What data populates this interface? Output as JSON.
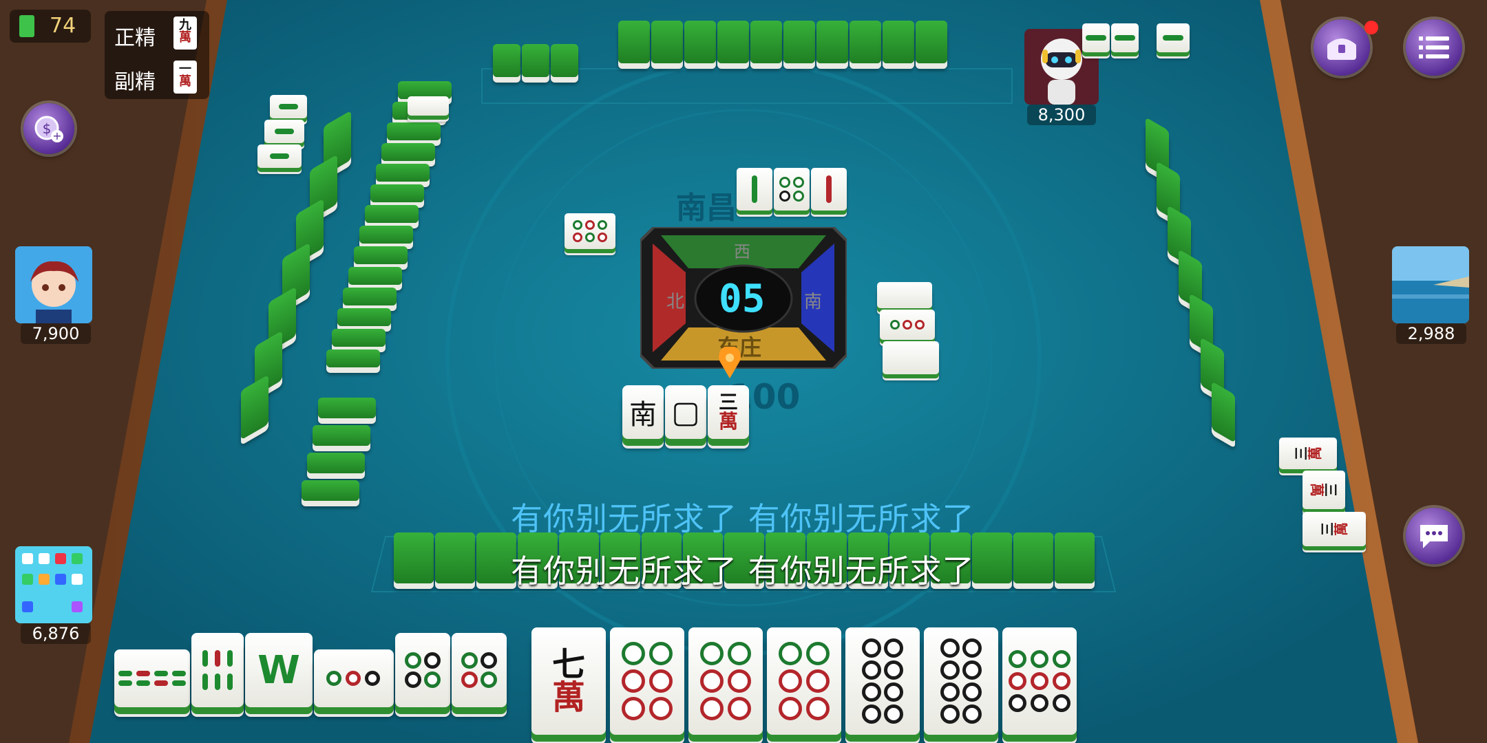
{
  "status": {
    "battery": "74"
  },
  "jing": {
    "zheng_label": "正精",
    "zheng_tile": {
      "num": "九",
      "suit": "萬"
    },
    "fu_label": "副精",
    "fu_tile": {
      "num": "一",
      "suit": "萬"
    }
  },
  "players": {
    "top": {
      "score": "8,300",
      "avatar_icon": "robot-avatar-icon"
    },
    "left": {
      "score": "7,900",
      "avatar_icon": "boy-avatar-icon"
    },
    "right": {
      "score": "2,988",
      "avatar_icon": "seaside-photo-avatar"
    },
    "self": {
      "score": "6,876",
      "avatar_icon": "phone-screen-avatar"
    }
  },
  "table": {
    "watermark": "南昌",
    "base_points": "100"
  },
  "compass": {
    "countdown": "05",
    "north": "北",
    "south": "南",
    "west": "西",
    "dealer": "东庄"
  },
  "discards": {
    "center": [
      {
        "type": "text",
        "value": "南"
      },
      {
        "type": "text",
        "value": "▢"
      },
      {
        "type": "wan",
        "num": "三",
        "suit": "萬"
      }
    ]
  },
  "melds_right": [
    {
      "num": "三",
      "suit": "萬"
    },
    {
      "num": "三",
      "suit": "萬"
    },
    {
      "num": "三",
      "suit": "萬"
    }
  ],
  "hand": {
    "first": {
      "num": "七",
      "suit": "萬"
    }
  },
  "subtitles": {
    "line1": "有你别无所求了 有你别无所求了",
    "line2": "有你别无所求了 有你别无所求了"
  },
  "colors": {
    "felt": "#0e6f88",
    "tile_back": "#2fa034",
    "subtitle_blue": "#4fc3f7"
  },
  "icons": [
    "treasure-chest-icon",
    "menu-icon",
    "chat-icon",
    "add-coins-icon",
    "battery-icon",
    "turn-marker-icon"
  ]
}
